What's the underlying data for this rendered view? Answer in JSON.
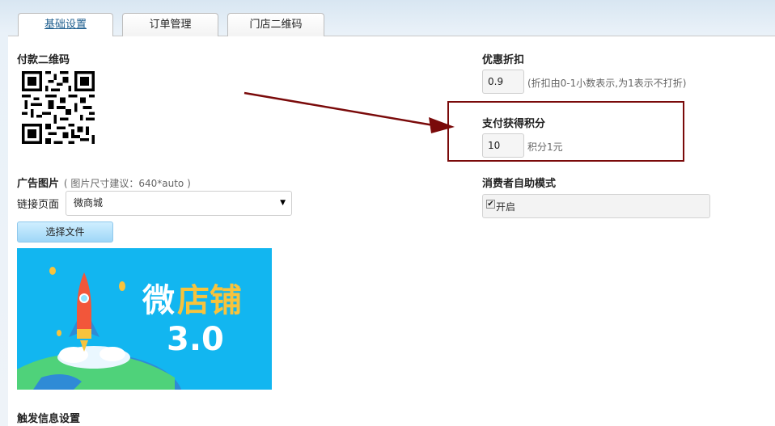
{
  "tabs": [
    {
      "label": "基础设置",
      "active": true
    },
    {
      "label": "订单管理",
      "active": false
    },
    {
      "label": "门店二维码",
      "active": false
    }
  ],
  "payment_qr": {
    "label": "付款二维码"
  },
  "ad_image": {
    "label": "广告图片",
    "hint": "( 图片尺寸建议：640*auto )",
    "link_label": "链接页面",
    "link_selected": "微商城",
    "choose_file": "选择文件",
    "banner": {
      "title_1": "微",
      "title_2": "店铺",
      "version": "3.0"
    }
  },
  "discount": {
    "label": "优惠折扣",
    "value": "0.9",
    "hint": "(折扣由0-1小数表示,为1表示不打折)"
  },
  "points": {
    "label": "支付获得积分",
    "value": "10",
    "hint": "积分1元"
  },
  "self_service": {
    "label": "消费者自助模式",
    "checkbox_label": "开启",
    "checked": true
  },
  "trigger": {
    "label": "触发信息设置"
  },
  "colors": {
    "highlight": "#7a0a0a",
    "banner_bg": "#12b6f0",
    "tab_link": "#1f5f8f"
  }
}
